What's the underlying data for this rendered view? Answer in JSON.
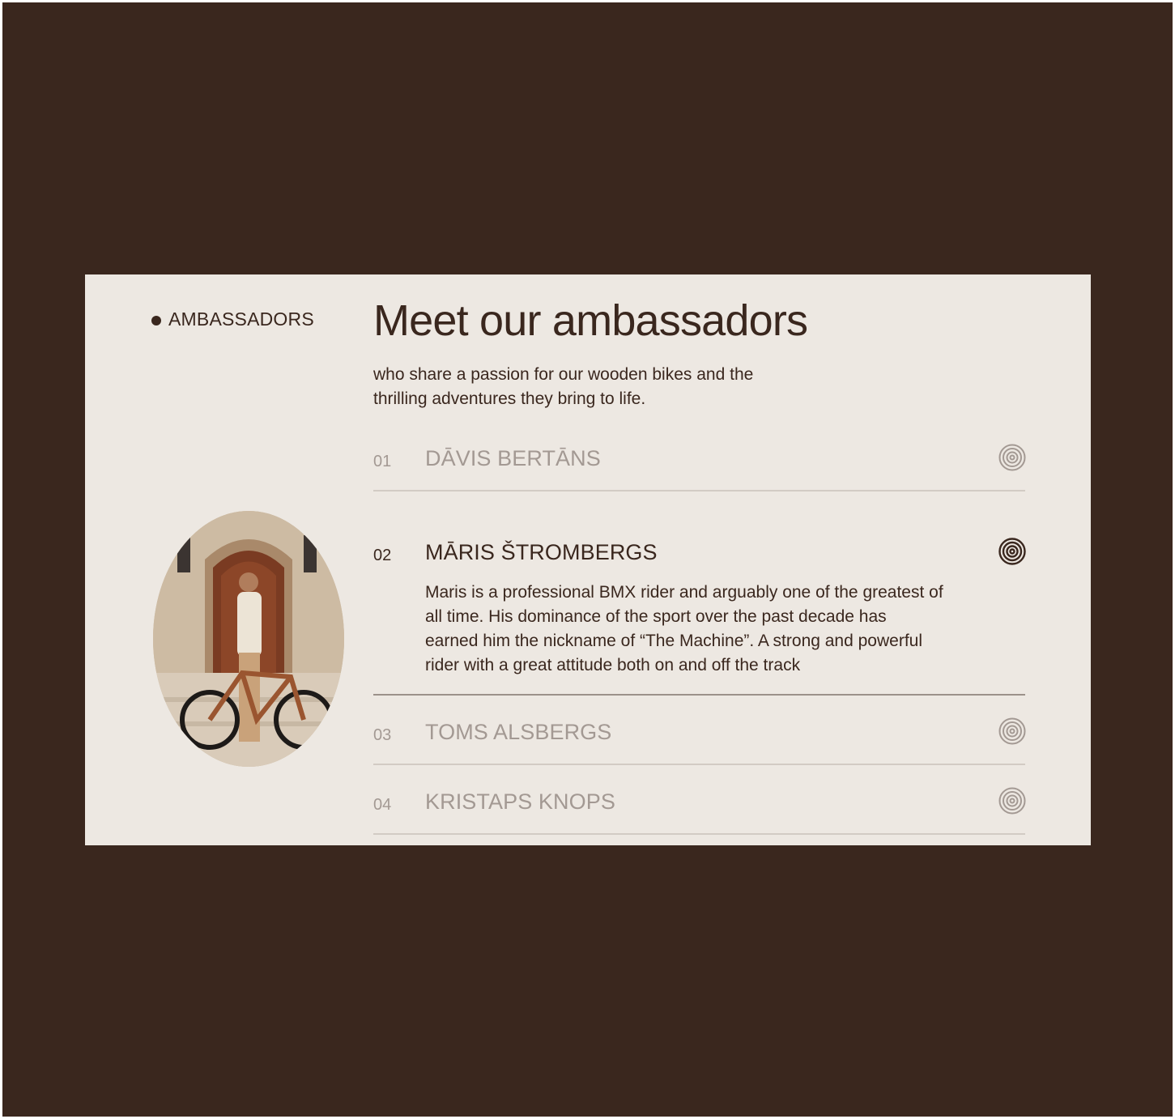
{
  "section_label": "AMBASSADORS",
  "heading": "Meet our ambassadors",
  "subtitle": {
    "line1": "who share a passion for our wooden bikes and the",
    "line2": "thrilling adventures they bring to life."
  },
  "colors": {
    "background": "#3a271e",
    "card": "#ede8e2",
    "text": "#3a271e",
    "muted": "#a39993"
  },
  "ambassadors": [
    {
      "number": "01",
      "name": "DĀVIS BERTĀNS",
      "icon": "tree-ring-icon",
      "active": false
    },
    {
      "number": "02",
      "name": "MĀRIS ŠTROMBERGS",
      "icon": "tree-ring-icon",
      "active": true,
      "description_lines": [
        "Maris is a professional BMX rider and arguably one of the greatest of",
        "all time. His dominance of the sport over the past decade has",
        "earned him the nickname of “The Machine”. A strong and powerful",
        "rider with a great attitude both on and off the track"
      ]
    },
    {
      "number": "03",
      "name": "TOMS ALSBERGS",
      "icon": "tree-ring-icon",
      "active": false
    },
    {
      "number": "04",
      "name": "KRISTAPS KNOPS",
      "icon": "tree-ring-icon",
      "active": false
    }
  ]
}
